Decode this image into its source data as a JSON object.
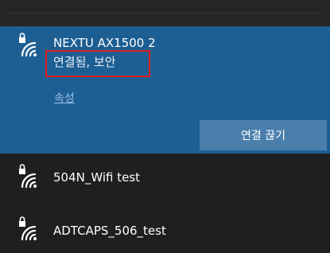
{
  "selected_network": {
    "name": "NEXTU AX1500 2",
    "status": "연결됨, 보안",
    "properties_link": "속성",
    "disconnect_button": "연결 끊기",
    "icon": "wifi-secured-icon"
  },
  "networks": [
    {
      "name": "504N_Wifi test",
      "icon": "wifi-secured-icon"
    },
    {
      "name": "ADTCAPS_506_test",
      "icon": "wifi-secured-icon"
    }
  ],
  "colors": {
    "background": "#1f1f1f",
    "selected_background": "#1d5f93",
    "button_background": "#4a7fab",
    "link_color": "#9cc4ea",
    "highlight_border": "#e01e1e"
  }
}
